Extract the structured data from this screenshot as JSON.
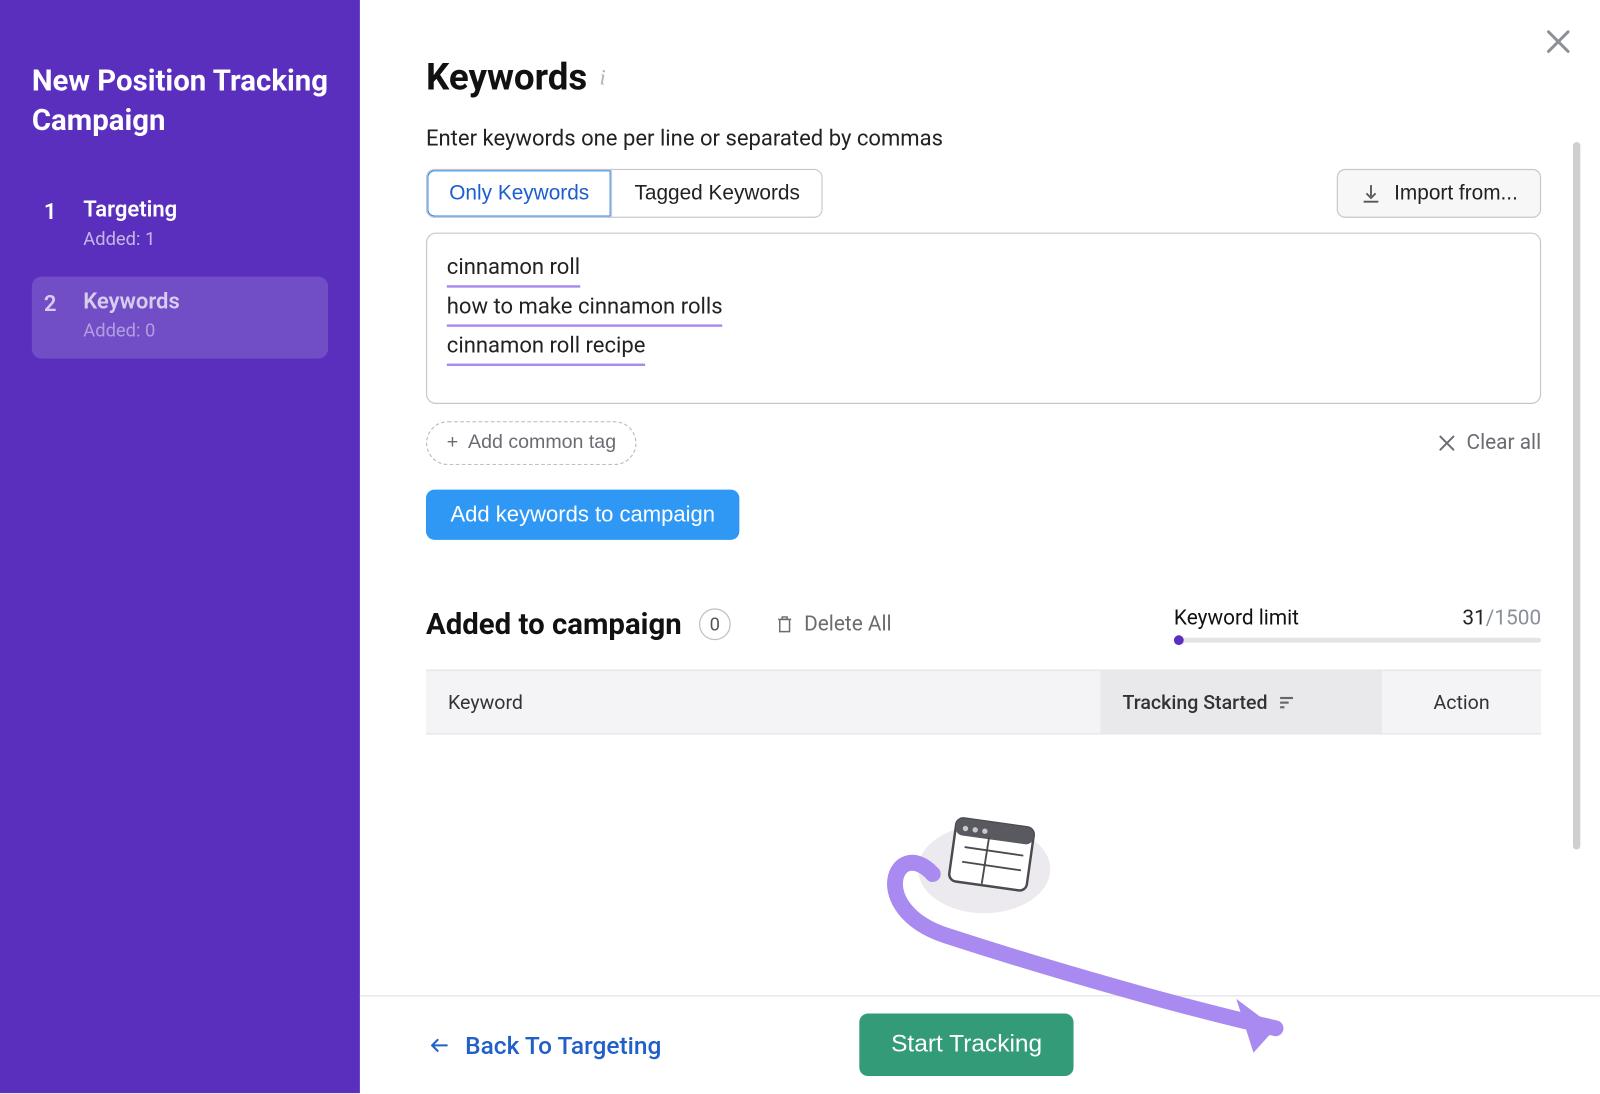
{
  "sidebar": {
    "title": "New Position Tracking Campaign",
    "steps": [
      {
        "number": "1",
        "label": "Targeting",
        "sub": "Added: 1"
      },
      {
        "number": "2",
        "label": "Keywords",
        "sub": "Added: 0"
      }
    ]
  },
  "header": {
    "title": "Keywords",
    "subtitle": "Enter keywords one per line or separated by commas"
  },
  "tabs": {
    "only": "Only Keywords",
    "tagged": "Tagged Keywords"
  },
  "import": {
    "label": "Import from..."
  },
  "textarea": {
    "lines": [
      "cinnamon roll",
      "how to make cinnamon rolls",
      "cinnamon roll recipe"
    ]
  },
  "tag_button": "Add common tag",
  "clear_all": "Clear all",
  "add_to_campaign": "Add keywords to campaign",
  "added": {
    "title": "Added to campaign",
    "count": "0",
    "delete_all": "Delete All",
    "limit_label": "Keyword limit",
    "limit_used": "31",
    "limit_total": "/1500"
  },
  "table": {
    "col_keyword": "Keyword",
    "col_tracking": "Tracking Started",
    "col_action": "Action"
  },
  "footer": {
    "back": "Back To Targeting",
    "start": "Start Tracking"
  }
}
